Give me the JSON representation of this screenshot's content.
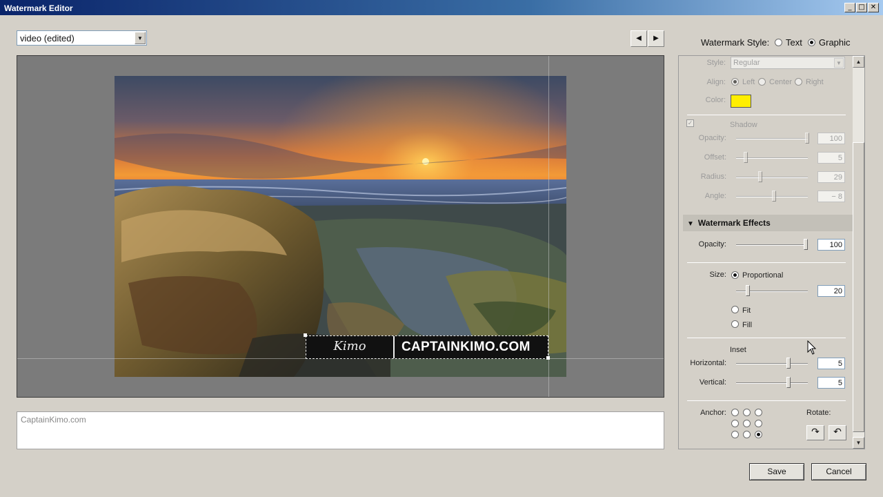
{
  "window": {
    "title": "Watermark Editor",
    "minimize_icon": "minimize-icon",
    "maximize_icon": "maximize-icon",
    "close_icon": "close-icon"
  },
  "preset": {
    "selected": "video (edited)"
  },
  "navigation": {
    "prev_icon": "triangle-left-icon",
    "next_icon": "triangle-right-icon"
  },
  "preview": {
    "watermark_text": "CAPTAINKIMO.COM",
    "signature_text": "Kimo"
  },
  "text_input": {
    "value": "CaptainKimo.com"
  },
  "watermark_style": {
    "label": "Watermark Style:",
    "options": [
      "Text",
      "Graphic"
    ],
    "selected": "Graphic"
  },
  "text_options": {
    "style_label": "Style:",
    "style_value": "Regular",
    "align_label": "Align:",
    "align_options": [
      "Left",
      "Center",
      "Right"
    ],
    "align_selected": "Left",
    "color_label": "Color:",
    "color_value": "#ffee00"
  },
  "shadow": {
    "label": "Shadow",
    "checked": true,
    "opacity_label": "Opacity:",
    "opacity_value": "100",
    "offset_label": "Offset:",
    "offset_value": "5",
    "radius_label": "Radius:",
    "radius_value": "29",
    "angle_label": "Angle:",
    "angle_value": "− 8"
  },
  "effects": {
    "header": "Watermark Effects",
    "opacity_label": "Opacity:",
    "opacity_value": "100",
    "size_label": "Size:",
    "size_options": [
      "Proportional",
      "Fit",
      "Fill"
    ],
    "size_selected": "Proportional",
    "size_value": "20",
    "inset_label": "Inset",
    "horizontal_label": "Horizontal:",
    "horizontal_value": "5",
    "vertical_label": "Vertical:",
    "vertical_value": "5",
    "anchor_label": "Anchor:",
    "anchor_selected": "bottom-right",
    "rotate_label": "Rotate:",
    "rotate_cw_icon": "rotate-clockwise-icon",
    "rotate_ccw_icon": "rotate-counterclockwise-icon"
  },
  "footer": {
    "save_label": "Save",
    "cancel_label": "Cancel"
  }
}
